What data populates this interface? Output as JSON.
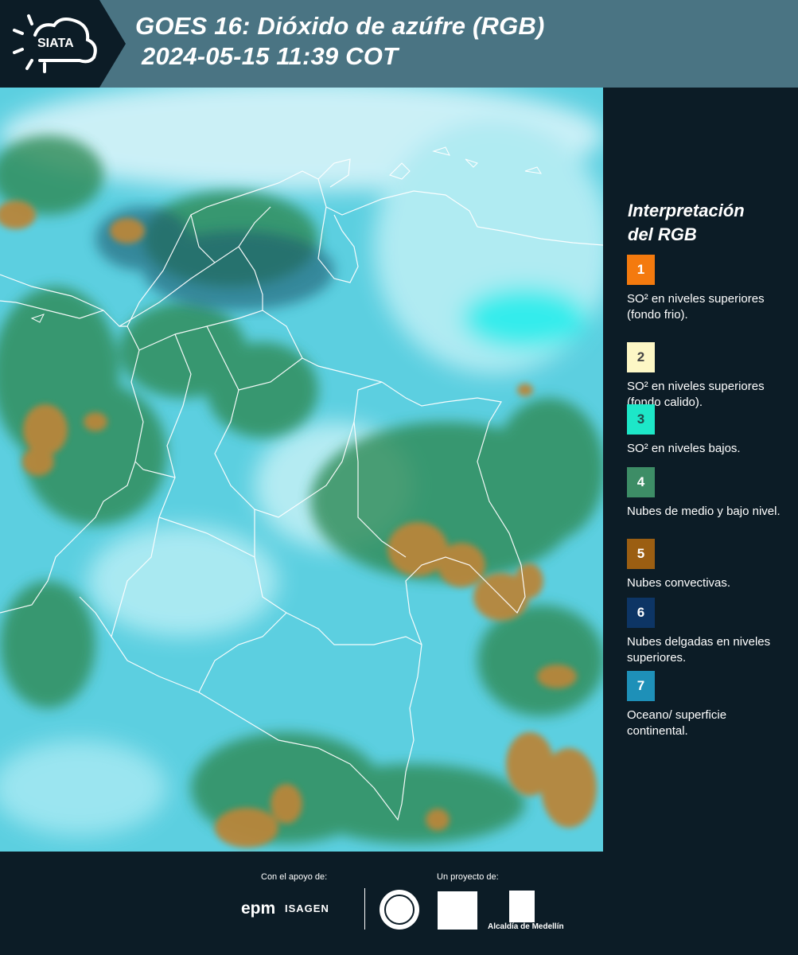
{
  "header": {
    "title_line1": "GOES 16: Dióxido de azúfre (RGB)",
    "title_line2": "2024-05-15 11:39 COT",
    "logo_text": "SIATA",
    "logo_icon": "sun-cloud-icon",
    "colors": {
      "band": "#4a7483",
      "background": "#0c1c26"
    }
  },
  "map": {
    "description": "satellite-image",
    "colors": {
      "cloud_cyan": "#5fd0e0",
      "land_green": "#2f8f5c",
      "convective_brown": "#b8863a",
      "border": "#ffffff"
    }
  },
  "legend": {
    "heading_line1": "Interpretación",
    "heading_line2": "del RGB",
    "items": [
      {
        "number": "1",
        "color": "#f47a0e",
        "text_color": "#ffffff",
        "label": "SO² en niveles superiores (fondo frio)."
      },
      {
        "number": "2",
        "color": "#fdf7c5",
        "text_color": "#444444",
        "label": "SO² en niveles superiores (fondo calido)."
      },
      {
        "number": "3",
        "color": "#1de7c8",
        "text_color": "#1f4a4a",
        "label": "SO² en niveles bajos."
      },
      {
        "number": "4",
        "color": "#3d8d66",
        "text_color": "#ffffff",
        "label": "Nubes de medio y bajo nivel."
      },
      {
        "number": "5",
        "color": "#9b5e12",
        "text_color": "#ffffff",
        "label": "Nubes convectivas."
      },
      {
        "number": "6",
        "color": "#0d3565",
        "text_color": "#ffffff",
        "label": "Nubes delgadas en niveles superiores."
      },
      {
        "number": "7",
        "color": "#1e90b8",
        "text_color": "#ffffff",
        "label": "Oceano/ superficie continental."
      }
    ]
  },
  "footer": {
    "support_label": "Con el apoyo de:",
    "project_label": "Un proyecto de:",
    "epm": "epm",
    "isagen": "ISAGEN",
    "alcaldia": "Alcaldía de Medellín"
  }
}
